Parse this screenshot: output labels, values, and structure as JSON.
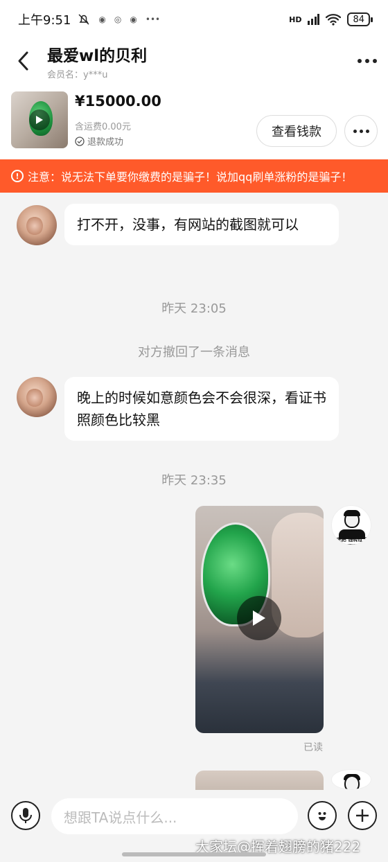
{
  "status_bar": {
    "time": "上午9:51",
    "network": "HD",
    "battery": "84"
  },
  "header": {
    "title": "最爱wl的贝利",
    "member": "会员名：y***u"
  },
  "product": {
    "price": "¥15000.00",
    "shipping": "含运费0.00元",
    "refund_status": "退款成功",
    "view_button": "查看钱款"
  },
  "warning": {
    "text": "注意：说无法下单要你缴费的是骗子！说加qq刷单涨粉的是骗子！"
  },
  "messages": {
    "msg1": "打不开，没事，有网站的截图就可以",
    "time1": "昨天 23:05",
    "recall": "对方撤回了一条消息",
    "msg2": "晚上的时候如意颜色会不会很深，看证书照颜色比较黑",
    "time2": "昨天 23:35",
    "read": "已读"
  },
  "avatar_right_caption": "完把 钱转过了再说",
  "input": {
    "placeholder": "想跟TA说点什么..."
  },
  "watermark": "大家坛@挥着翅膀的猪222",
  "icons": [
    "back-icon",
    "more-icon",
    "play-icon",
    "check-circle-icon",
    "warning-icon",
    "mic-icon",
    "emoji-icon",
    "plus-icon"
  ]
}
